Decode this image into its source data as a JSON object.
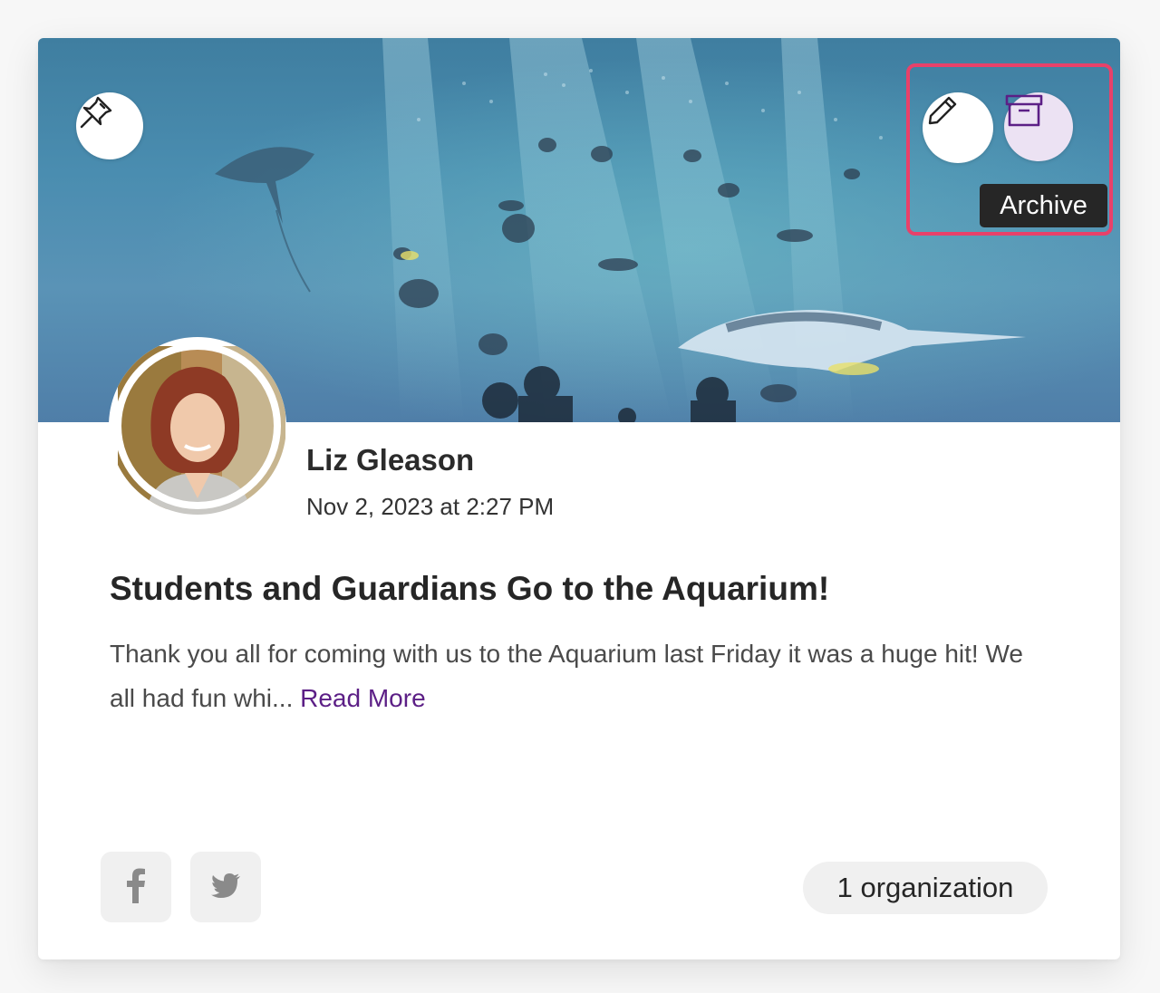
{
  "post": {
    "author": "Liz Gleason",
    "date": "Nov 2, 2023 at 2:27 PM",
    "title": "Students and Guardians Go to the Aquarium!",
    "excerpt": "Thank you all for coming with us to the Aquarium last Friday it was a huge hit! We all had fun whi... ",
    "read_more": "Read More",
    "organizations": "1 organization"
  },
  "actions": {
    "archive_tooltip": "Archive"
  },
  "icons": {
    "pin": "pushpin-icon",
    "edit": "pencil-icon",
    "archive": "archive-box-icon",
    "facebook": "facebook-icon",
    "twitter": "twitter-icon"
  },
  "colors": {
    "accent": "#5c1f86",
    "archive_button_bg": "#ece2f3",
    "highlight_border": "#e8416a",
    "tooltip_bg": "#262626"
  }
}
